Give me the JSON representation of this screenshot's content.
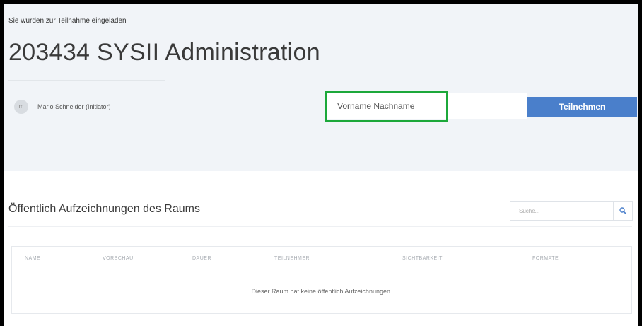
{
  "invitation": "Sie wurden zur Teilnahme eingeladen",
  "room_title": "203434 SYSII Administration",
  "initiator": {
    "avatar_initials": "m",
    "name": "Mario Schneider (Initiator)"
  },
  "join_form": {
    "name_placeholder": "Vorname Nachname",
    "join_label": "Teilnehmen"
  },
  "recordings": {
    "heading": "Öffentlich Aufzeichnungen des Raums",
    "search_placeholder": "Suche...",
    "columns": [
      "NAME",
      "VORSCHAU",
      "DAUER",
      "TEILNEHMER",
      "SICHTBARKEIT",
      "FORMATE"
    ],
    "empty_message": "Dieser Raum hat keine öffentlich Aufzeichnungen."
  },
  "colors": {
    "accent": "#4a7fcb",
    "highlight": "#1ca83a",
    "header_background": "#f1f4f8"
  }
}
